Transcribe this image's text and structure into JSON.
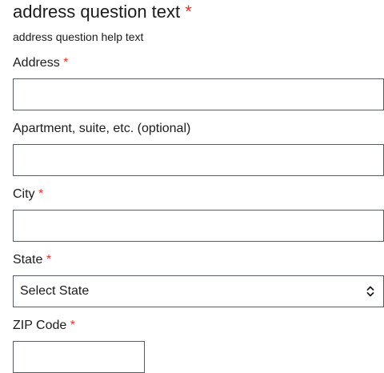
{
  "question": {
    "title": "address question text",
    "required_mark": "*",
    "help_text": "address question help text"
  },
  "fields": {
    "address": {
      "label": "Address",
      "required_mark": "*",
      "value": ""
    },
    "apartment": {
      "label": "Apartment, suite, etc. (optional)",
      "value": ""
    },
    "city": {
      "label": "City",
      "required_mark": "*",
      "value": ""
    },
    "state": {
      "label": "State",
      "required_mark": "*",
      "selected": "Select State",
      "icon": "chevron-up-down-icon"
    },
    "zip": {
      "label": "ZIP Code",
      "required_mark": "*",
      "value": ""
    }
  },
  "colors": {
    "required": "#d83933",
    "border": "#565c65",
    "text": "#1b1b1b"
  }
}
